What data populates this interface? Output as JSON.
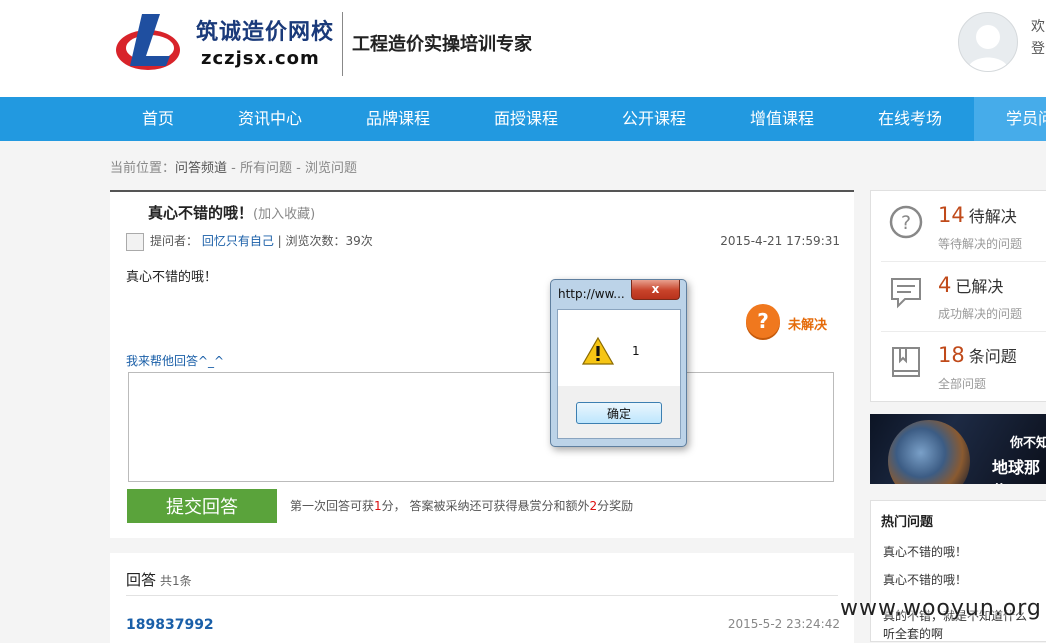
{
  "header": {
    "logo_cn": "筑诚造价网校",
    "logo_en": "zczjsx.com",
    "slogan": "工程造价实操培训专家",
    "welcome_line1": "欢",
    "welcome_line2": "登"
  },
  "nav": {
    "items": [
      "首页",
      "资讯中心",
      "品牌课程",
      "面授课程",
      "公开课程",
      "增值课程",
      "在线考场",
      "学员问"
    ]
  },
  "breadcrumb": {
    "prefix": "当前位置：",
    "channel": "问答频道",
    "sep1": " - ",
    "all": "所有问题",
    "sep2": " - ",
    "current": "浏览问题"
  },
  "question": {
    "title": "真心不错的哦！",
    "favorite": "(加入收藏)",
    "asker_label": "提问者：",
    "asker": "回忆只有自己",
    "views": " | 浏览次数：39次",
    "date": "2015-4-21 17:59:31",
    "body": "真心不错的哦！",
    "status": "未解决",
    "help_label": "我来帮他回答^_^",
    "submit_label": "提交回答",
    "reward_1": "第一次回答可获",
    "reward_n1": "1",
    "reward_2": "分， 答案被采纳还可获得悬赏分和额外",
    "reward_n2": "2",
    "reward_3": "分奖励"
  },
  "answers": {
    "heading": "回答",
    "count": "共1条",
    "items": [
      {
        "user": "189837992",
        "date": "2015-5-2 23:24:42"
      }
    ]
  },
  "sidebar": {
    "stats": [
      {
        "num": "14",
        "label": "待解决",
        "sub": "等待解决的问题"
      },
      {
        "num": "4",
        "label": "已解决",
        "sub": "成功解决的问题"
      },
      {
        "num": "18",
        "label": "条问题",
        "sub": "全部问题"
      }
    ],
    "banner_line1": "你不知",
    "banner_line2": "地球那些",
    "hot_title": "热门问题",
    "hot_items": [
      "真心不错的哦！",
      "真心不错的哦！",
      "真的不错，就是不知道什么",
      "听全套的啊"
    ]
  },
  "watermark": "www.wooyun.org",
  "dialog": {
    "title": "http://ww...",
    "message": "1",
    "ok_label": "确定",
    "close_label": "x"
  }
}
